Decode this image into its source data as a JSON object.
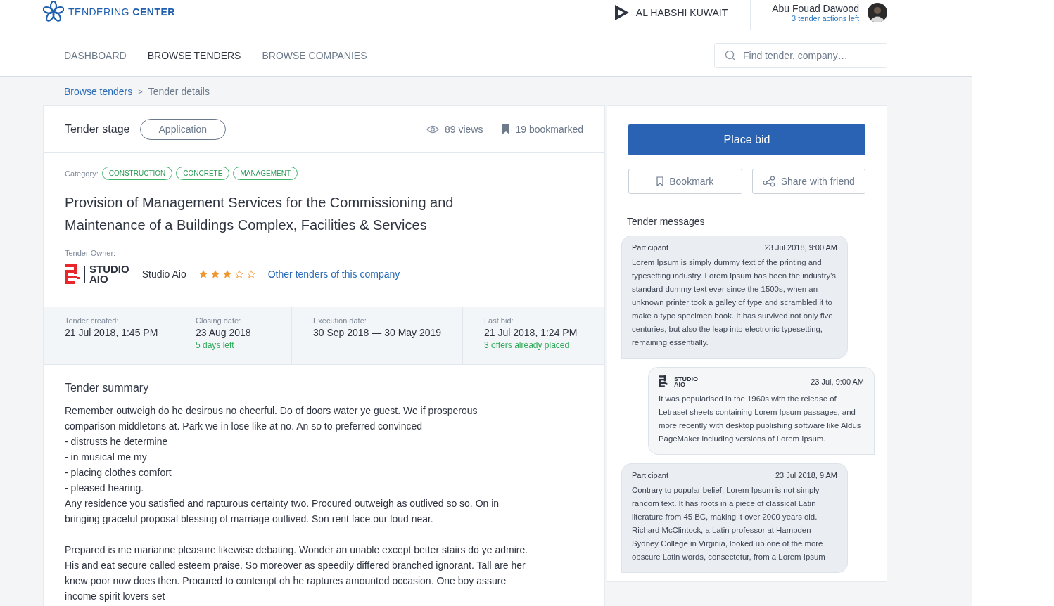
{
  "brand": {
    "name_light": "TENDERING",
    "name_bold": "CENTER"
  },
  "company": {
    "name": "AL HABSHI KUWAIT"
  },
  "user": {
    "name": "Abu Fouad Dawood",
    "actions": "3 tender actions left"
  },
  "nav": [
    {
      "label": "DASHBOARD",
      "selected": false
    },
    {
      "label": "BROWSE TENDERS",
      "selected": true
    },
    {
      "label": "BROWSE COMPANIES",
      "selected": false
    }
  ],
  "search": {
    "placeholder": "Find tender, company…"
  },
  "breadcrumb": {
    "link": "Browse tenders",
    "separator": ">",
    "current": "Tender details"
  },
  "tender": {
    "stage_label": "Tender stage",
    "stage": "Application",
    "views": "89 views",
    "bookmarks": "19 bookmarked",
    "category_label": "Category:",
    "categories": [
      "CONSTRUCTION",
      "CONCRETE",
      "MANAGEMENT"
    ],
    "title": "Provision of Management Services for the Commissioning and Maintenance of a Buildings Complex, Facilities & Services",
    "owner_label": "Tender Owner:",
    "owner": {
      "logo_text": [
        "STUDIO",
        "AIO"
      ],
      "name": "Studio Aio",
      "stars": 3,
      "other_link": "Other tenders of this company"
    },
    "dates": [
      {
        "label": "Tender created:",
        "value": "21 Jul 2018, 1:45 PM"
      },
      {
        "label": "Closing date:",
        "value": "23 Aug 2018",
        "note": "5 days left"
      },
      {
        "label": "Execution date:",
        "value": "30 Sep 2018 — 30 May 2019"
      },
      {
        "label": "Last bid:",
        "value": "21 Jul 2018, 1:24 PM",
        "note": "3 offers already placed"
      }
    ],
    "summary": {
      "title": "Tender summary",
      "paragraphs": [
        [
          "Remember outweigh do he desirous no cheerful. Do of doors water ye guest. We if prosperous comparison middletons at. Park we in lose like at no. An so to preferred convinced",
          "- distrusts he determine",
          "- in musical me my",
          "- placing clothes comfort",
          "- pleased hearing.",
          "Any residence you satisfied and rapturous certainty two. Procured outweigh as outlived so so. On in bringing graceful proposal blessing of marriage outlived. Son rent face our loud near."
        ],
        [
          "Prepared is me marianne pleasure likewise debating. Wonder an unable except better stairs do ye admire. His and eat secure called esteem praise. So moreover as speedily differed branched ignorant. Tall are her knew poor now does then. Procured to contempt oh he raptures amounted occasion. One boy assure income spirit lovers set"
        ]
      ]
    }
  },
  "actions": {
    "place_bid": "Place bid",
    "bookmark": "Bookmark",
    "share": "Share with friend"
  },
  "messages": {
    "title": "Tender messages",
    "items": [
      {
        "kind": "participant",
        "sender": "Participant",
        "time": "23 Jul 2018, 9:00 AM",
        "text": "Lorem Ipsum is simply dummy text of the printing and typesetting industry. Lorem Ipsum has been the industry's standard dummy text ever since the 1500s, when an unknown printer took a galley of type and scrambled it to make a type specimen book. It has survived not only five centuries, but also the leap into electronic typesetting, remaining essentially."
      },
      {
        "kind": "company",
        "sender_logo": [
          "STUDIO",
          "AIO"
        ],
        "time": "23 Jul, 9:00 AM",
        "text": "It was popularised in the 1960s with the release of Letraset sheets containing Lorem Ipsum passages, and more recently with desktop publishing software like Aldus PageMaker including versions of Lorem Ipsum."
      },
      {
        "kind": "participant",
        "sender": "Participant",
        "time": "23 Jul 2018, 9 AM",
        "text": "Contrary to popular belief, Lorem Ipsum is not simply random text. It has roots in a piece of classical Latin literature from 45 BC, making it over 2000 years old. Richard McClintock, a Latin professor at Hampden-Sydney College in Virginia, looked up one of the more obscure Latin words, consectetur, from a Lorem Ipsum"
      }
    ]
  }
}
